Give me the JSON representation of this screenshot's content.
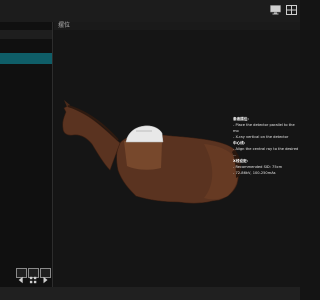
{
  "window": {
    "tab_label": "摆位"
  },
  "toolbar": {
    "icons": [
      "monitor-icon",
      "layout-icon"
    ]
  },
  "left_panel": {
    "bottom_buttons": [
      "prev-icon",
      "grid-icon",
      "next-icon"
    ]
  },
  "info": {
    "section1_title": "患者摆位:",
    "section1_line1": "- Place the detector parallel to the mo",
    "section1_line2": "- X-ray vertical on the detector",
    "section2_title": "中心线:",
    "section2_line1": "- Align the central ray to the desired ...",
    "section3_title": "X线设定:",
    "section3_line1": "- Recommended SID: 75cm",
    "section3_line2": "- 72-86kV, 100-250mAs"
  },
  "colors": {
    "accent": "#0f5e68",
    "horse": "#5a3320",
    "detector_plate": "#e8e8e8"
  }
}
